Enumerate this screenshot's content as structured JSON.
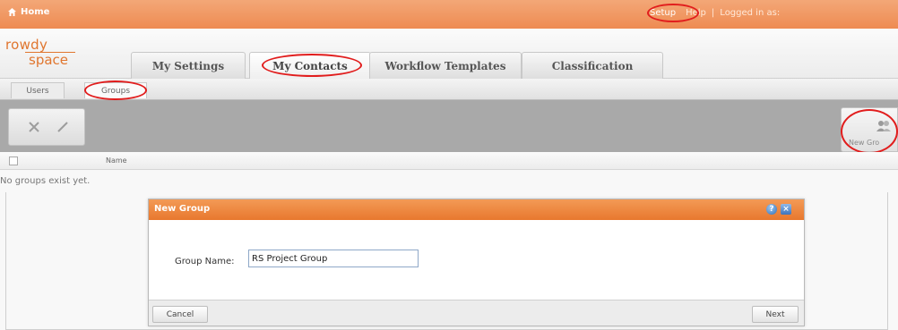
{
  "topbar": {
    "home_label": "Home",
    "setup_label": "Setup",
    "separator": "|",
    "help_label": "Help",
    "logged_in_label": "Logged in as:"
  },
  "logo": {
    "line1": "rowdy",
    "line2": "space"
  },
  "tabs": [
    {
      "label": "My Settings"
    },
    {
      "label": "My Contacts"
    },
    {
      "label": "Workflow Templates"
    },
    {
      "label": "Classification"
    }
  ],
  "subtabs": [
    {
      "label": "Users"
    },
    {
      "label": "Groups"
    }
  ],
  "toolbar": {
    "new_group_label": "New Gro"
  },
  "list": {
    "column_name": "Name",
    "empty_message": "No groups exist yet."
  },
  "dialog": {
    "title": "New Group",
    "field_label": "Group Name:",
    "field_value": "RS Project Group",
    "cancel_label": "Cancel",
    "next_label": "Next"
  },
  "colors": {
    "topbar": "#ee8b52",
    "dialog_title": "#e8782e",
    "annotation": "#e11d1d",
    "toolbar": "#a9a9a9"
  }
}
